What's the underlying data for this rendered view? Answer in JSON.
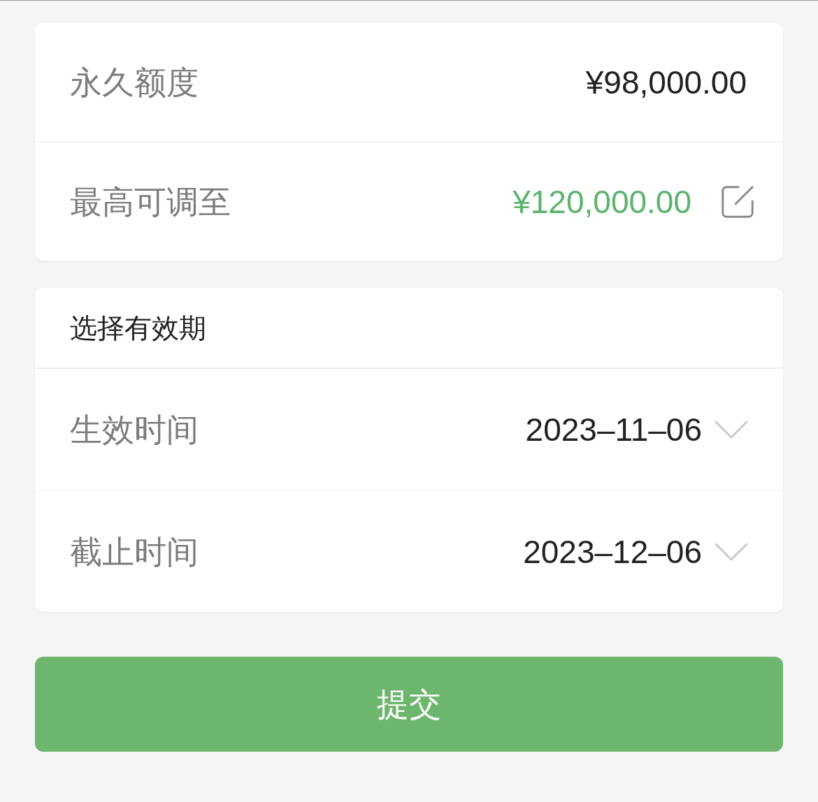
{
  "limits": [
    {
      "kind": "plain",
      "label": "永久额度",
      "value": "¥98,000.00"
    },
    {
      "kind": "editable",
      "label": "最高可调至",
      "value": "¥120,000.00"
    }
  ],
  "validity": {
    "title": "选择有效期",
    "fields": [
      {
        "label": "生效时间",
        "value": "2023–11–06"
      },
      {
        "label": "截止时间",
        "value": "2023–12–06"
      }
    ]
  },
  "submit_button": {
    "label": "提交"
  }
}
